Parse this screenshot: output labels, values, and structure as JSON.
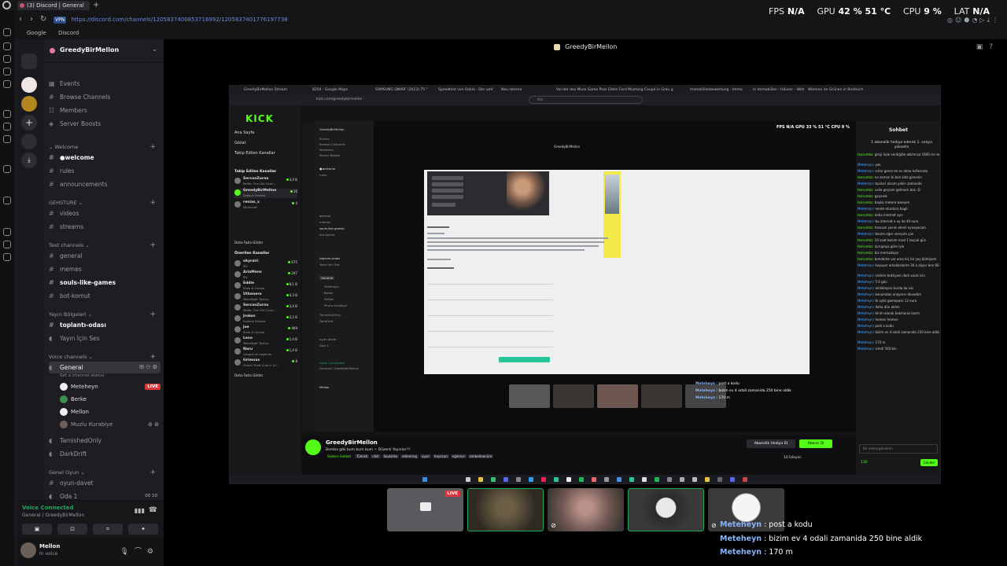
{
  "browser": {
    "tab_title": "(3) Discord | General",
    "url": "https://discord.com/channels/1205837400853716992/1205837401776197738",
    "vpn_label": "VPN",
    "bookmarks": [
      "Google",
      "Discord"
    ]
  },
  "overlay": {
    "fps_label": "FPS",
    "fps_value": "N/A",
    "gpu_label": "GPU",
    "gpu_value": "42 % 51 °C",
    "cpu_label": "CPU",
    "cpu_value": "9 %",
    "lat_label": "LAT",
    "lat_value": "N/A"
  },
  "guild": {
    "name": "GreedyBirMellon",
    "menu": [
      "Events",
      "Browse Channels",
      "Members",
      "Server Boosts"
    ]
  },
  "categories": {
    "welcome": "Welcome",
    "gehsture": "GEHSTURE",
    "text": "Text channels",
    "yayin": "Yayın Bölgeleri",
    "voice": "Voice channels",
    "genel_oyun": "Genel Oyun"
  },
  "channels": {
    "welcome": "●welcome",
    "rules": "rules",
    "announcements": "announcements",
    "videos": "videos",
    "streams": "streams",
    "general": "general",
    "memes": "memes",
    "souls": "souls-like-games",
    "botkomut": "bot-komut",
    "toplanti": "toplantı-odası",
    "yayin_icin_ses": "Yayın İçin Ses",
    "voice_general": "General",
    "voice_general_status": "Set a channel status",
    "tarnished": "TarnishedOnly",
    "darkdrift": "DarkDrift",
    "oyun_davet": "oyun-davet",
    "oda1": "Oda 1",
    "oda1_count_a": "00",
    "oda1_count_b": "10"
  },
  "voice_users": [
    "Meteheyn",
    "Berke",
    "Mellon",
    "Muzlu Kurabiye"
  ],
  "live_badge": "LIVE",
  "voice_panel": {
    "status": "Voice Connected",
    "location": "General / GreedyBirMellon"
  },
  "user_panel": {
    "name": "Mellon",
    "status": "In voice"
  },
  "stream": {
    "header": "GreedyBirMellon"
  },
  "shared_screen": {
    "tabs": [
      "GreedyBirMellon Stream",
      "8204 - Google Maps",
      "SAMSUNG QN90F (2023) 75 \"",
      "Speedtest von Ookla - Der umf",
      "Neu laterne",
      "Vol der des Muse Game Pass Edeln",
      "Ford Mustang Coupé in Grau g",
      "Immobilienbewertung - Immo",
      "In Immobilien - Häuser - Woh",
      "Wohnen im Grünen in Breiteich"
    ],
    "url": "kick.com/greedybirmellon",
    "search": "Ara",
    "kick_logo": "KICK",
    "kick_nav": [
      "Ana Sayfa",
      "Gözat",
      "Takip Edilen Kanallar"
    ],
    "followed_title": "Takip Edilen Kanallar",
    "followed": [
      {
        "name": "SercanZurna",
        "game": "Mafia: The Old Coun...",
        "count": "3,4 B"
      },
      {
        "name": "GreedyBirMellon",
        "game": "Sadece Sohbet",
        "count": "10"
      },
      {
        "name": "renias_x",
        "game": "Minecraft",
        "count": "4"
      }
    ],
    "more": "Daha Fazla Göster",
    "recommended_title": "Önerilen Kanallar",
    "recommended": [
      {
        "name": "okyrairi",
        "game": "IRL",
        "count": "675"
      },
      {
        "name": "AriaMons",
        "game": "IRL",
        "count": "247"
      },
      {
        "name": "Eddie",
        "game": "Slots & Casino",
        "count": "8,1 B"
      },
      {
        "name": "Uthenera",
        "game": "Teamfight Tactics",
        "count": "4,3 B"
      },
      {
        "name": "SercanZurna",
        "game": "Mafia: The Old Coun...",
        "count": "3,4 B"
      },
      {
        "name": "Jrokez",
        "game": "Sadece Sohbet",
        "count": "3,2 B"
      },
      {
        "name": "joe",
        "game": "Slots & Casino",
        "count": "469"
      },
      {
        "name": "Levo",
        "game": "Teamfight Tactics",
        "count": "1,4 B"
      },
      {
        "name": "Naru",
        "game": "League of Legends",
        "count": "1,4 B"
      },
      {
        "name": "Grimnax",
        "game": "Grand Theft Auto V (G...",
        "count": "8"
      }
    ],
    "inner_perf": "FPS N/A  GPU 33 % 51 °C  CPU 9 %",
    "inner_header": "GreedyBirMellon",
    "inner_chat": [
      {
        "who": "Meteheyn",
        "text": " : post a kodu"
      },
      {
        "who": "Meteheyn",
        "text": " : bizim ev 4 odali zamanida 250 bine aldik"
      },
      {
        "who": "Meteheyn",
        "text": " : 170 m"
      }
    ],
    "chat_title": "Sohbet",
    "chat_notice": "1 abonelik hediye ederek 1. sıraya yükselin",
    "chat_lines": [
      {
        "who": "tearumbs",
        "text": ": girişi öyle verdiğide aklımnca 1600 mi ne ediyor :D"
      },
      {
        "who": "Meteheyn",
        "text": ": yok"
      },
      {
        "who": "Meteheyn",
        "text": ": sırlar genel de ev alma kafasında"
      },
      {
        "who": "tearumbs",
        "text": ": ne zaman bi ben kidz girecein"
      },
      {
        "who": "Meteheyn",
        "text": ": bunlari alcam yakin zamanda"
      },
      {
        "who": "tearumbs",
        "text": ": valla geçrom gelmem bak :D"
      },
      {
        "who": "tearumbs",
        "text": ": geçerek"
      },
      {
        "who": "tearumbs",
        "text": ": başka metere bakıyım"
      },
      {
        "who": "Meteheyn",
        "text": ": nerde oturdura bagli"
      },
      {
        "who": "tearumbs",
        "text": ": daha internet ayrı"
      },
      {
        "who": "Meteheyn",
        "text": ": bu internet e ay da 40 euro"
      },
      {
        "who": "tearumbs",
        "text": ": hoscam yasını ekmil oynayacam"
      },
      {
        "who": "Meteheyn",
        "text": ": benim eğer vereyim çan"
      },
      {
        "who": "tearumbs",
        "text": ": 10 saat benim nasıl 1 buçuk gün"
      },
      {
        "who": "tearumbs",
        "text": ": avrupaya göre iyle"
      },
      {
        "who": "tearumbs",
        "text": ": biz memadayız"
      },
      {
        "who": "tearumbs",
        "text": ": benderde var ama hiç bir şey bilmiyom"
      },
      {
        "who": "Meteheyn",
        "text": ": kuyuyor arkadaslarim 30 a aliyor ben 60 a"
      },
      {
        "who": "Meteheyn",
        "text": ": indirim bekliyom dark souls icin"
      },
      {
        "who": "Meteheyn",
        "text": ": 5 6 gün"
      },
      {
        "who": "Meteheyn",
        "text": ": emlikleyon burda da var"
      },
      {
        "who": "Meteheyn",
        "text": ": konumdan anlıyorsr devedim"
      },
      {
        "who": "Meteheyn",
        "text": ": bi aylık gamepass 12 euro"
      },
      {
        "who": "Meteheyn",
        "text": ": daha dün aldım"
      },
      {
        "who": "Meteheyn",
        "text": ": birim olarak bakmanız lazım"
      },
      {
        "who": "Meteheyn",
        "text": ": hemen hemen"
      },
      {
        "who": "Meteheyn",
        "text": ": post a kodu"
      },
      {
        "who": "Meteheyn",
        "text": ": bizim ev 4 odali zamanida 250 bine aldık"
      },
      {
        "who": "Meteheyn",
        "text": ": 170 m"
      },
      {
        "who": "Meteheyn",
        "text": ": simdi 500 bin"
      }
    ],
    "chat_placeholder": "Bir mesaj gönderin",
    "chat_send": "Gönder",
    "chat_points": "130",
    "streamer_name": "GreedyBirMellon",
    "stream_title": "Bomba gibi bum bum bum ~ Düzenli Yayınlar!!!",
    "stream_tags": [
      "Sadece Sohbet",
      "Türkish",
      "chill",
      "Soulslike",
      "eldenring",
      "oyun",
      "heyecan",
      "eğlence",
      "zımbelmenüre"
    ],
    "gift_button": "Abonelik Hediye Et",
    "subscribe_button": "Abone Ol",
    "viewers": "10 İzleyici"
  },
  "bottom_chat": [
    {
      "who": "Meteheyn",
      "text": " : post a kodu"
    },
    {
      "who": "Meteheyn",
      "text": " : bizim ev 4 odali zamanida 250 bine aldik"
    },
    {
      "who": "Meteheyn",
      "text": " : 170 m"
    }
  ],
  "colors": {
    "accent_green": "#23a55a",
    "kick_green": "#53fc18",
    "live_red": "#da373c",
    "link_blue": "#8ab4f8"
  }
}
